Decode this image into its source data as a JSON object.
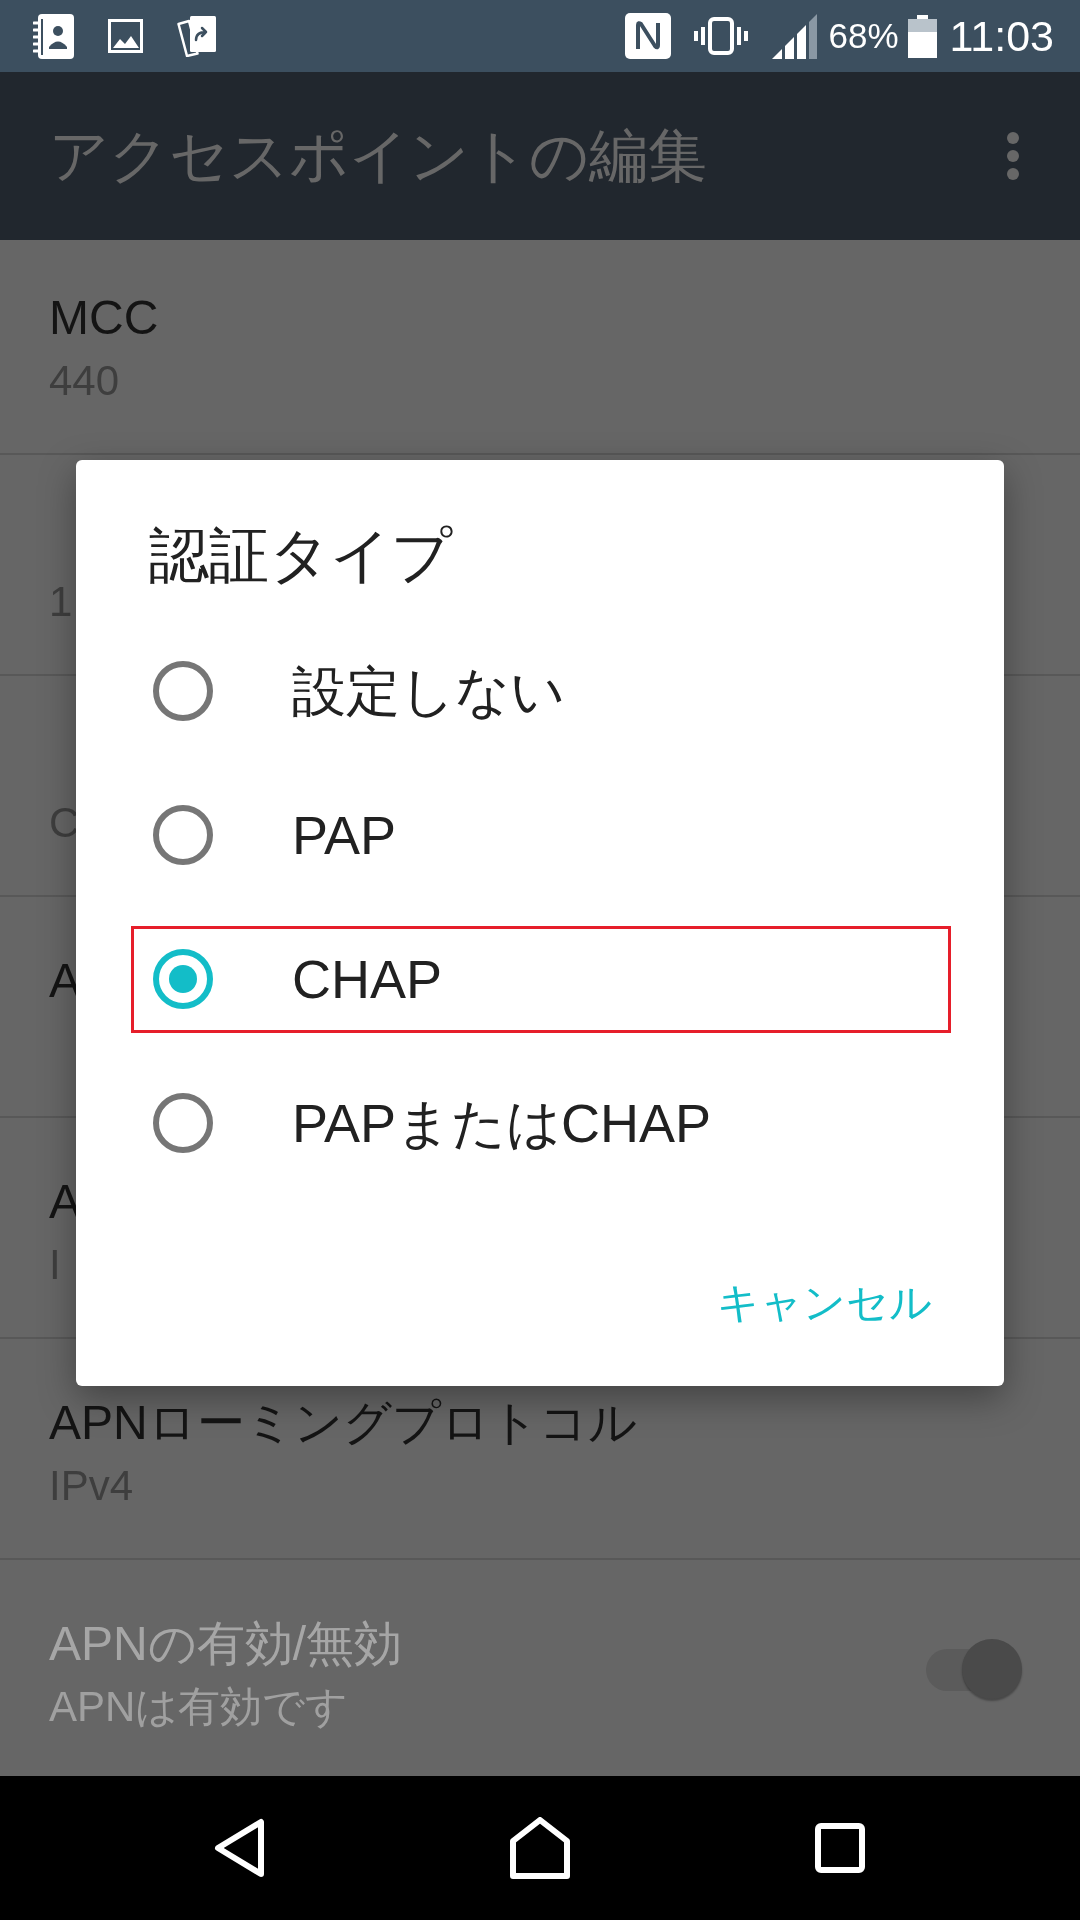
{
  "status_bar": {
    "battery_percent": "68%",
    "time": "11:03"
  },
  "toolbar": {
    "title": "アクセスポイントの編集"
  },
  "settings": [
    {
      "kind": "text",
      "title": "MCC",
      "summary": "440",
      "disabled": false
    },
    {
      "kind": "text",
      "summary": "1",
      "disabled": false
    },
    {
      "kind": "text",
      "summary": "C",
      "disabled": false
    },
    {
      "kind": "text",
      "title": "A",
      "disabled": false
    },
    {
      "kind": "text",
      "title": "A",
      "summary": "I",
      "disabled": false
    },
    {
      "kind": "text",
      "title": "APNローミングプロトコル",
      "summary": "IPv4",
      "disabled": false
    },
    {
      "kind": "switch",
      "title": "APNの有効/無効",
      "summary": "APNは有効です",
      "disabled": true,
      "on": true
    }
  ],
  "auth_dialog": {
    "title": "認証タイプ",
    "options": [
      {
        "label": "設定しない",
        "selected": false,
        "highlighted": false
      },
      {
        "label": "PAP",
        "selected": false,
        "highlighted": false
      },
      {
        "label": "CHAP",
        "selected": true,
        "highlighted": true
      },
      {
        "label": "PAPまたはCHAP",
        "selected": false,
        "highlighted": false
      }
    ],
    "cancel_button": "キャンセル"
  }
}
